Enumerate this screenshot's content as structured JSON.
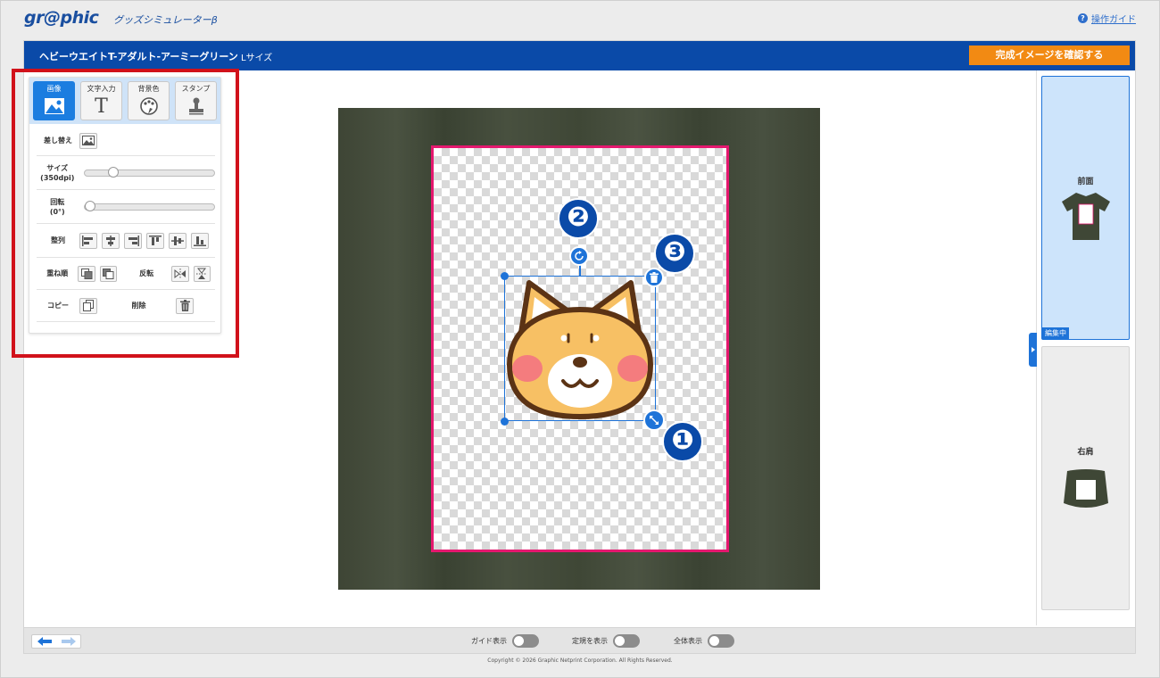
{
  "header": {
    "logo": "gr@phic",
    "logo_sub": "グッズシミュレーターβ",
    "guide_link": "操作ガイド"
  },
  "titlebar": {
    "product": "ヘビーウエイトT-アダルト-アーミーグリーン",
    "size": "Lサイズ",
    "confirm_button": "完成イメージを確認する"
  },
  "tools": {
    "tabs": [
      {
        "label": "画像",
        "icon": "image-icon",
        "active": true
      },
      {
        "label": "文字入力",
        "icon": "text-icon",
        "active": false
      },
      {
        "label": "背景色",
        "icon": "palette-icon",
        "active": false
      },
      {
        "label": "スタンプ",
        "icon": "stamp-icon",
        "active": false
      }
    ],
    "replace_label": "差し替え",
    "size_label": "サイズ",
    "size_unit": "(350dpi)",
    "size_value": 0.2,
    "rotate_label": "回転",
    "rotate_unit": "(0°)",
    "rotate_value": 0,
    "align_label": "整列",
    "order_label": "重ね順",
    "flip_label": "反転",
    "copy_label": "コピー",
    "delete_label": "削除"
  },
  "badges": [
    "❷",
    "❸",
    "❶"
  ],
  "views": {
    "front": "前面",
    "editing": "編集中",
    "shoulder": "右肩"
  },
  "bottom": {
    "guide_toggle": "ガイド表示",
    "ruler_toggle": "定規を表示",
    "full_toggle": "全体表示"
  },
  "copyright": "Copyright © 2026 Graphic Netprint Corporation. All Rights Reserved.",
  "colors": {
    "brand_blue": "#0a4aa8",
    "accent_orange": "#f28a13",
    "selection_blue": "#1e73d8",
    "print_area_border": "#e5186f",
    "highlight_red": "#d1121b"
  }
}
